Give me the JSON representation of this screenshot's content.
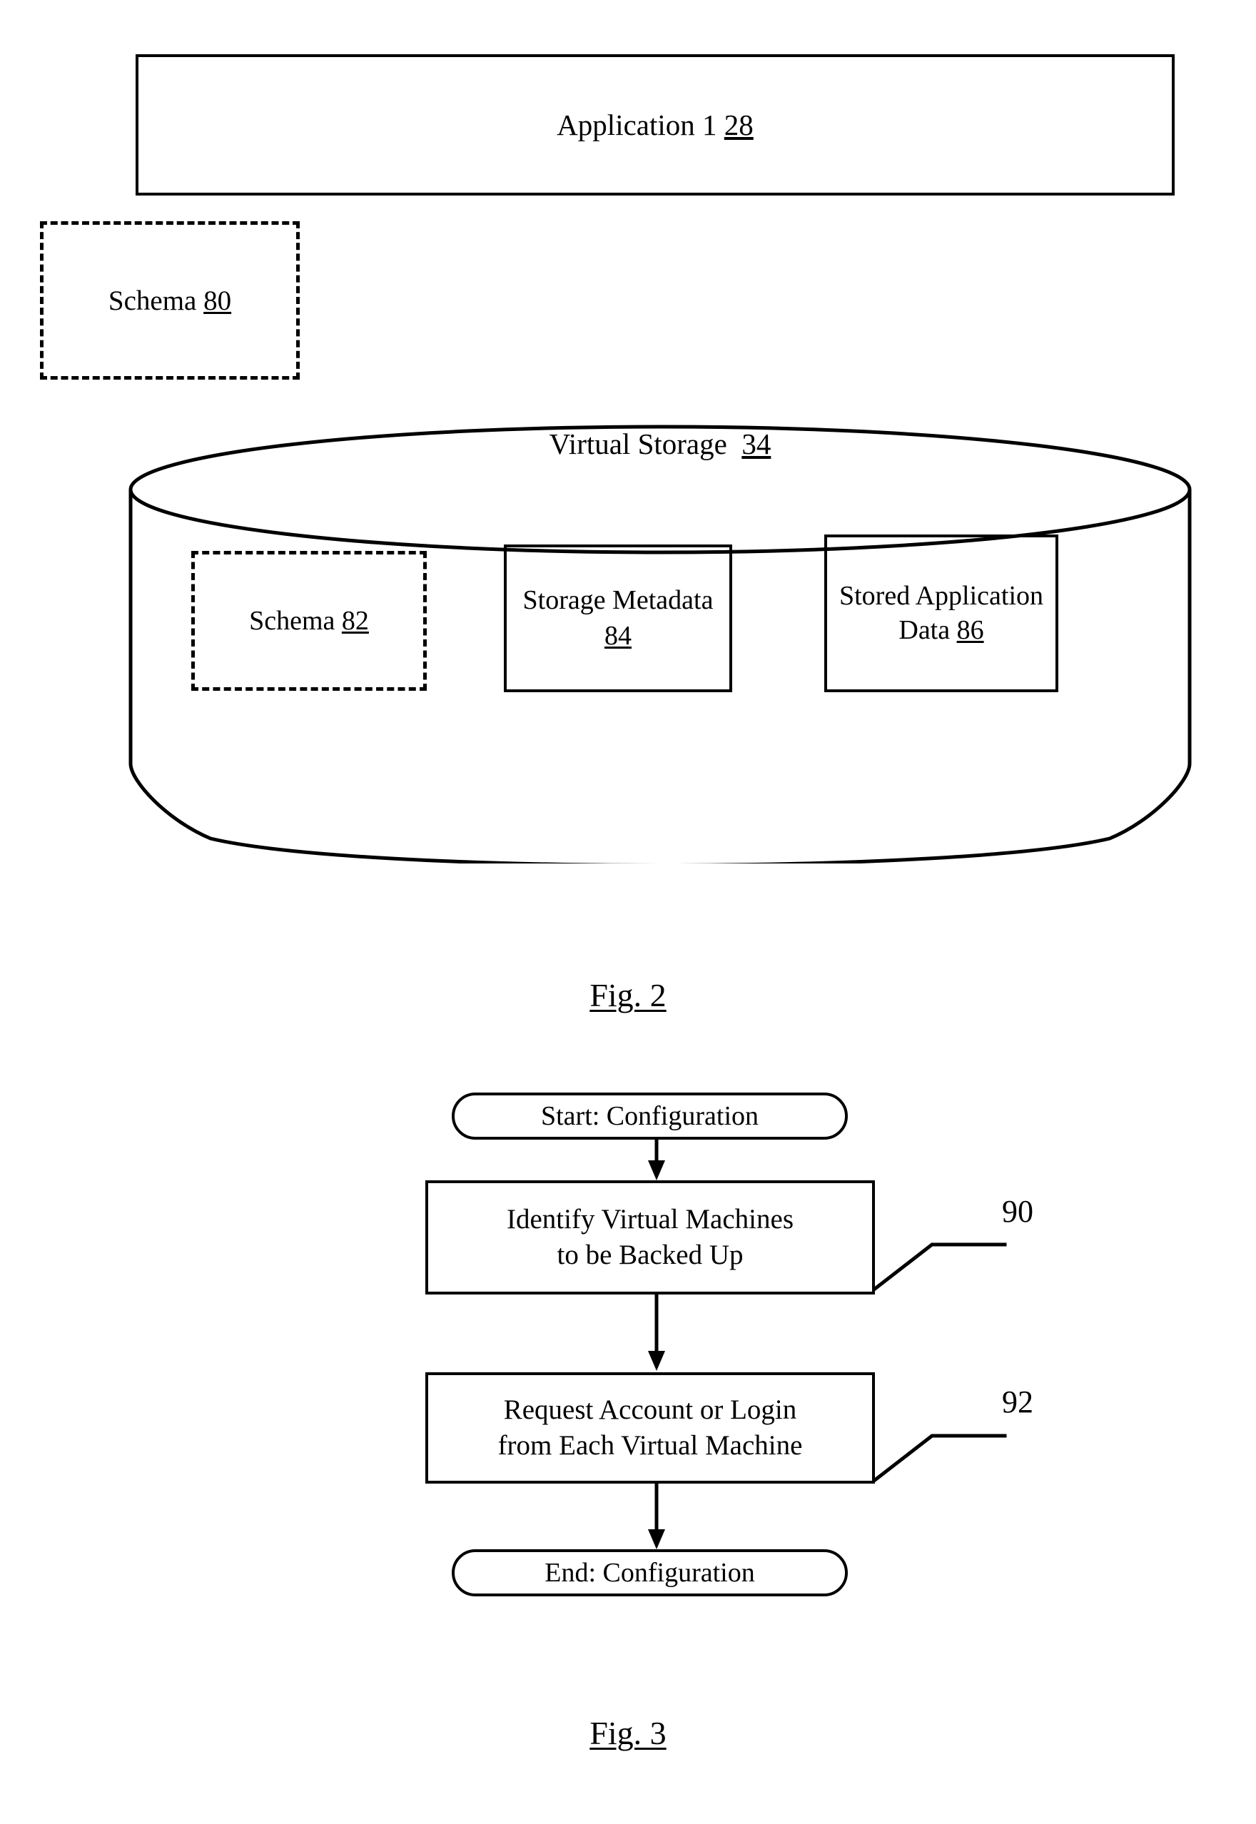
{
  "figure2": {
    "caption": "Fig. 2",
    "application_box": {
      "label": "Application 1",
      "ref": "28"
    },
    "schema_outer": {
      "label": "Schema",
      "ref": "80"
    },
    "virtual_storage": {
      "label": "Virtual Storage",
      "ref": "34",
      "items": [
        {
          "label": "Schema",
          "ref": "82",
          "style": "dashed"
        },
        {
          "label": "Storage\nMetadata",
          "ref": "84",
          "style": "solid"
        },
        {
          "label": "Stored\nApplication\nData",
          "ref": "86",
          "style": "solid"
        }
      ]
    }
  },
  "figure3": {
    "caption": "Fig. 3",
    "start_node": "Start:  Configuration",
    "end_node": "End:  Configuration",
    "steps": [
      {
        "text": "Identify Virtual Machines\nto be Backed Up",
        "ref": "90"
      },
      {
        "text": "Request Account or Login\nfrom Each Virtual Machine",
        "ref": "92"
      }
    ]
  },
  "colors": {
    "ink": "#000000",
    "paper": "#ffffff"
  }
}
